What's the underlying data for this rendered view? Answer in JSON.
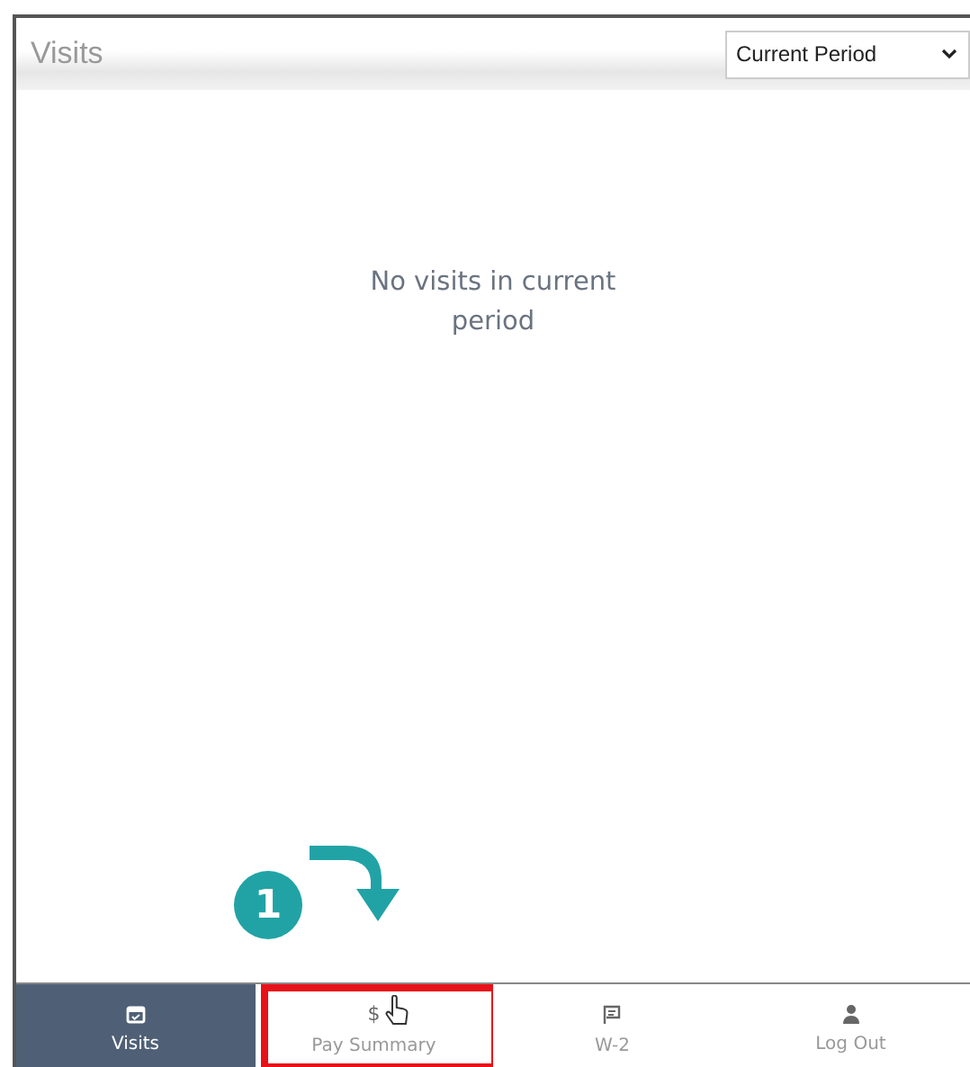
{
  "header": {
    "title": "Visits",
    "period_select": {
      "value": "Current Period"
    }
  },
  "empty_message": "No visits in current period",
  "annotation": {
    "step": "1"
  },
  "nav": [
    {
      "label": "Visits",
      "kind": "calendar",
      "selected": true,
      "highlighted": false
    },
    {
      "label": "Pay Summary",
      "kind": "dollar",
      "glyph": "$",
      "selected": false,
      "highlighted": true
    },
    {
      "label": "W-2",
      "kind": "form",
      "selected": false,
      "highlighted": false
    },
    {
      "label": "Log Out",
      "kind": "person",
      "selected": false,
      "highlighted": false
    }
  ]
}
